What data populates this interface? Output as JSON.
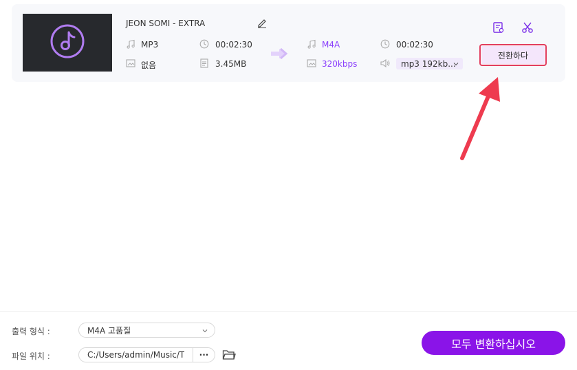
{
  "item": {
    "title": "JEON SOMI - EXTRA",
    "source": {
      "format": "MP3",
      "duration": "00:02:30",
      "subtitle": "없음",
      "size": "3.45MB"
    },
    "target": {
      "format": "M4A",
      "duration": "00:02:30",
      "bitrate": "320kbps",
      "audio_track": "mp3 192kb..."
    },
    "convert_label": "전환하다"
  },
  "footer": {
    "output_format_label": "출력 형식 :",
    "output_format_value": "M4A 고품질",
    "file_location_label": "파일 위치 :",
    "file_location_value": "C:/Users/admin/Music/T",
    "browse_label": "···",
    "convert_all_label": "모두 변환하십시오"
  },
  "colors": {
    "accent": "#8a14e8",
    "highlight_border": "#e23c5d",
    "arrow": "#ee3b4f"
  }
}
